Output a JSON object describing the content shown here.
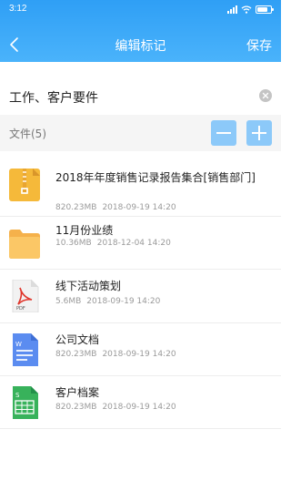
{
  "status_bar": {
    "time": "3:12"
  },
  "nav": {
    "back_icon": "chevron-left-icon",
    "title": "编辑标记",
    "save_label": "保存"
  },
  "tag": {
    "text": "工作、客户要件",
    "clear_icon": "clear-circle-icon"
  },
  "files_header": {
    "label": "文件(5)",
    "remove_icon": "minus-icon",
    "add_icon": "plus-icon"
  },
  "files": [
    {
      "icon": "zip-file-icon",
      "name": "2018年年度销售记录报告集合[销售部门]",
      "size": "820.23MB",
      "date": "2018-09-19 14:20"
    },
    {
      "icon": "folder-icon",
      "name": "11月份业绩",
      "size": "10.36MB",
      "date": "2018-12-04 14:20"
    },
    {
      "icon": "pdf-file-icon",
      "name": "线下活动策划",
      "size": "5.6MB",
      "date": "2018-09-19 14:20"
    },
    {
      "icon": "word-doc-icon",
      "name": "公司文档",
      "size": "820.23MB",
      "date": "2018-09-19 14:20"
    },
    {
      "icon": "spreadsheet-icon",
      "name": "客户档案",
      "size": "820.23MB",
      "date": "2018-09-19 14:20"
    }
  ],
  "colors": {
    "header": "#3aa8f8",
    "button": "#8cc9f9"
  }
}
